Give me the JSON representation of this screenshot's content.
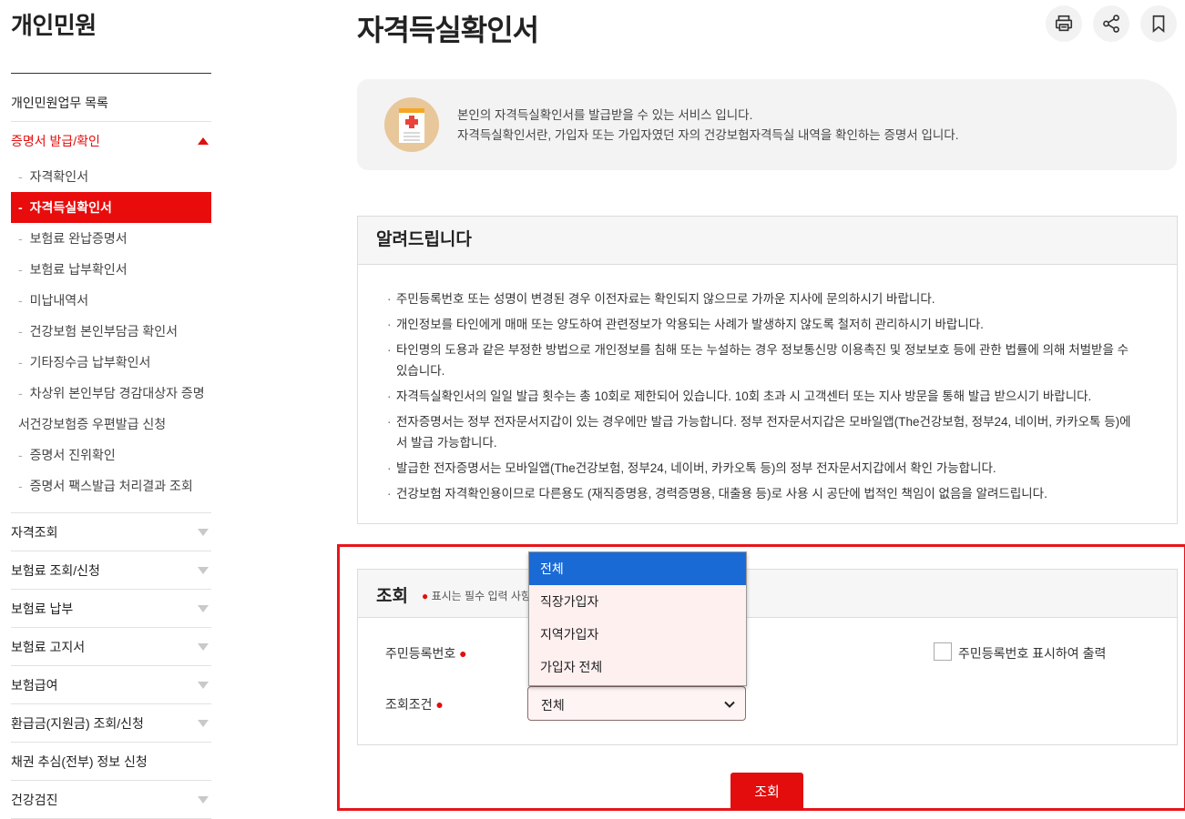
{
  "sidebar": {
    "title": "개인민원",
    "top_item": "개인민원업무 목록",
    "active_section": "증명서 발급/확인",
    "sub_items": [
      {
        "label": "자격확인서",
        "active": false
      },
      {
        "label": "자격득실확인서",
        "active": true
      },
      {
        "label": "보험료 완납증명서",
        "active": false
      },
      {
        "label": "보험료 납부확인서",
        "active": false
      },
      {
        "label": "미납내역서",
        "active": false
      },
      {
        "label": "건강보험 본인부담금 확인서",
        "active": false
      },
      {
        "label": "기타징수금 납부확인서",
        "active": false
      },
      {
        "label": "차상위 본인부담 경감대상자 증명서",
        "active": false
      },
      {
        "label": "건강보험증 우편발급 신청",
        "active": false
      },
      {
        "label": "증명서 진위확인",
        "active": false
      },
      {
        "label": "증명서 팩스발급 처리결과 조회",
        "active": false
      }
    ],
    "sections": [
      {
        "label": "자격조회",
        "expandable": true
      },
      {
        "label": "보험료 조회/신청",
        "expandable": true
      },
      {
        "label": "보험료 납부",
        "expandable": true
      },
      {
        "label": "보험료 고지서",
        "expandable": true
      },
      {
        "label": "보험급여",
        "expandable": true
      },
      {
        "label": "환급금(지원금) 조회/신청",
        "expandable": true
      },
      {
        "label": "채권 추심(전부) 정보 신청",
        "expandable": false
      },
      {
        "label": "건강검진",
        "expandable": true
      }
    ]
  },
  "page": {
    "title": "자격득실확인서",
    "tools": [
      "print-icon",
      "share-icon",
      "bookmark-icon"
    ]
  },
  "intro": {
    "line1": "본인의 자격득실확인서를 발급받을 수 있는 서비스 입니다.",
    "line2": "자격득실확인서란, 가입자 또는 가입자였던 자의 건강보험자격득실 내역을 확인하는 증명서 입니다."
  },
  "notice": {
    "title": "알려드립니다",
    "items": [
      "주민등록번호 또는 성명이 변경된 경우 이전자료는 확인되지 않으므로 가까운 지사에 문의하시기 바랍니다.",
      "개인정보를 타인에게 매매 또는 양도하여 관련정보가 악용되는 사례가 발생하지 않도록 철저히 관리하시기 바랍니다.",
      "타인명의 도용과 같은 부정한 방법으로 개인정보를 침해 또는 누설하는 경우 정보통신망 이용촉진 및 정보보호 등에 관한 법률에 의해 처벌받을 수 있습니다.",
      "자격득실확인서의 일일 발급 횟수는 총 10회로 제한되어 있습니다. 10회 초과 시 고객센터 또는 지사 방문을 통해 발급 받으시기 바랍니다.",
      "전자증명서는 정부 전자문서지갑이 있는 경우에만 발급 가능합니다. 정부 전자문서지갑은 모바일앱(The건강보험, 정부24, 네이버, 카카오톡 등)에서 발급 가능합니다.",
      "발급한 전자증명서는 모바일앱(The건강보험, 정부24, 네이버, 카카오톡 등)의 정부 전자문서지갑에서 확인 가능합니다.",
      "건강보험 자격확인용이므로 다른용도 (재직증명용, 경력증명용, 대출용 등)로 사용 시 공단에 법적인 책임이 없음을 알려드립니다."
    ]
  },
  "search": {
    "title": "조회",
    "hint": "표시는 필수 입력 사항",
    "rrn_label": "주민등록번호",
    "condition_label": "조회조건",
    "checkbox_label": "주민등록번호 표시하여 출력",
    "select_value": "전체",
    "options": [
      "전체",
      "직장가입자",
      "지역가입자",
      "가입자 전체"
    ],
    "button": "조회"
  },
  "colors": {
    "accent": "#e30d0d",
    "highlight_border": "#e8151b",
    "selected_option": "#1a6ad6"
  }
}
